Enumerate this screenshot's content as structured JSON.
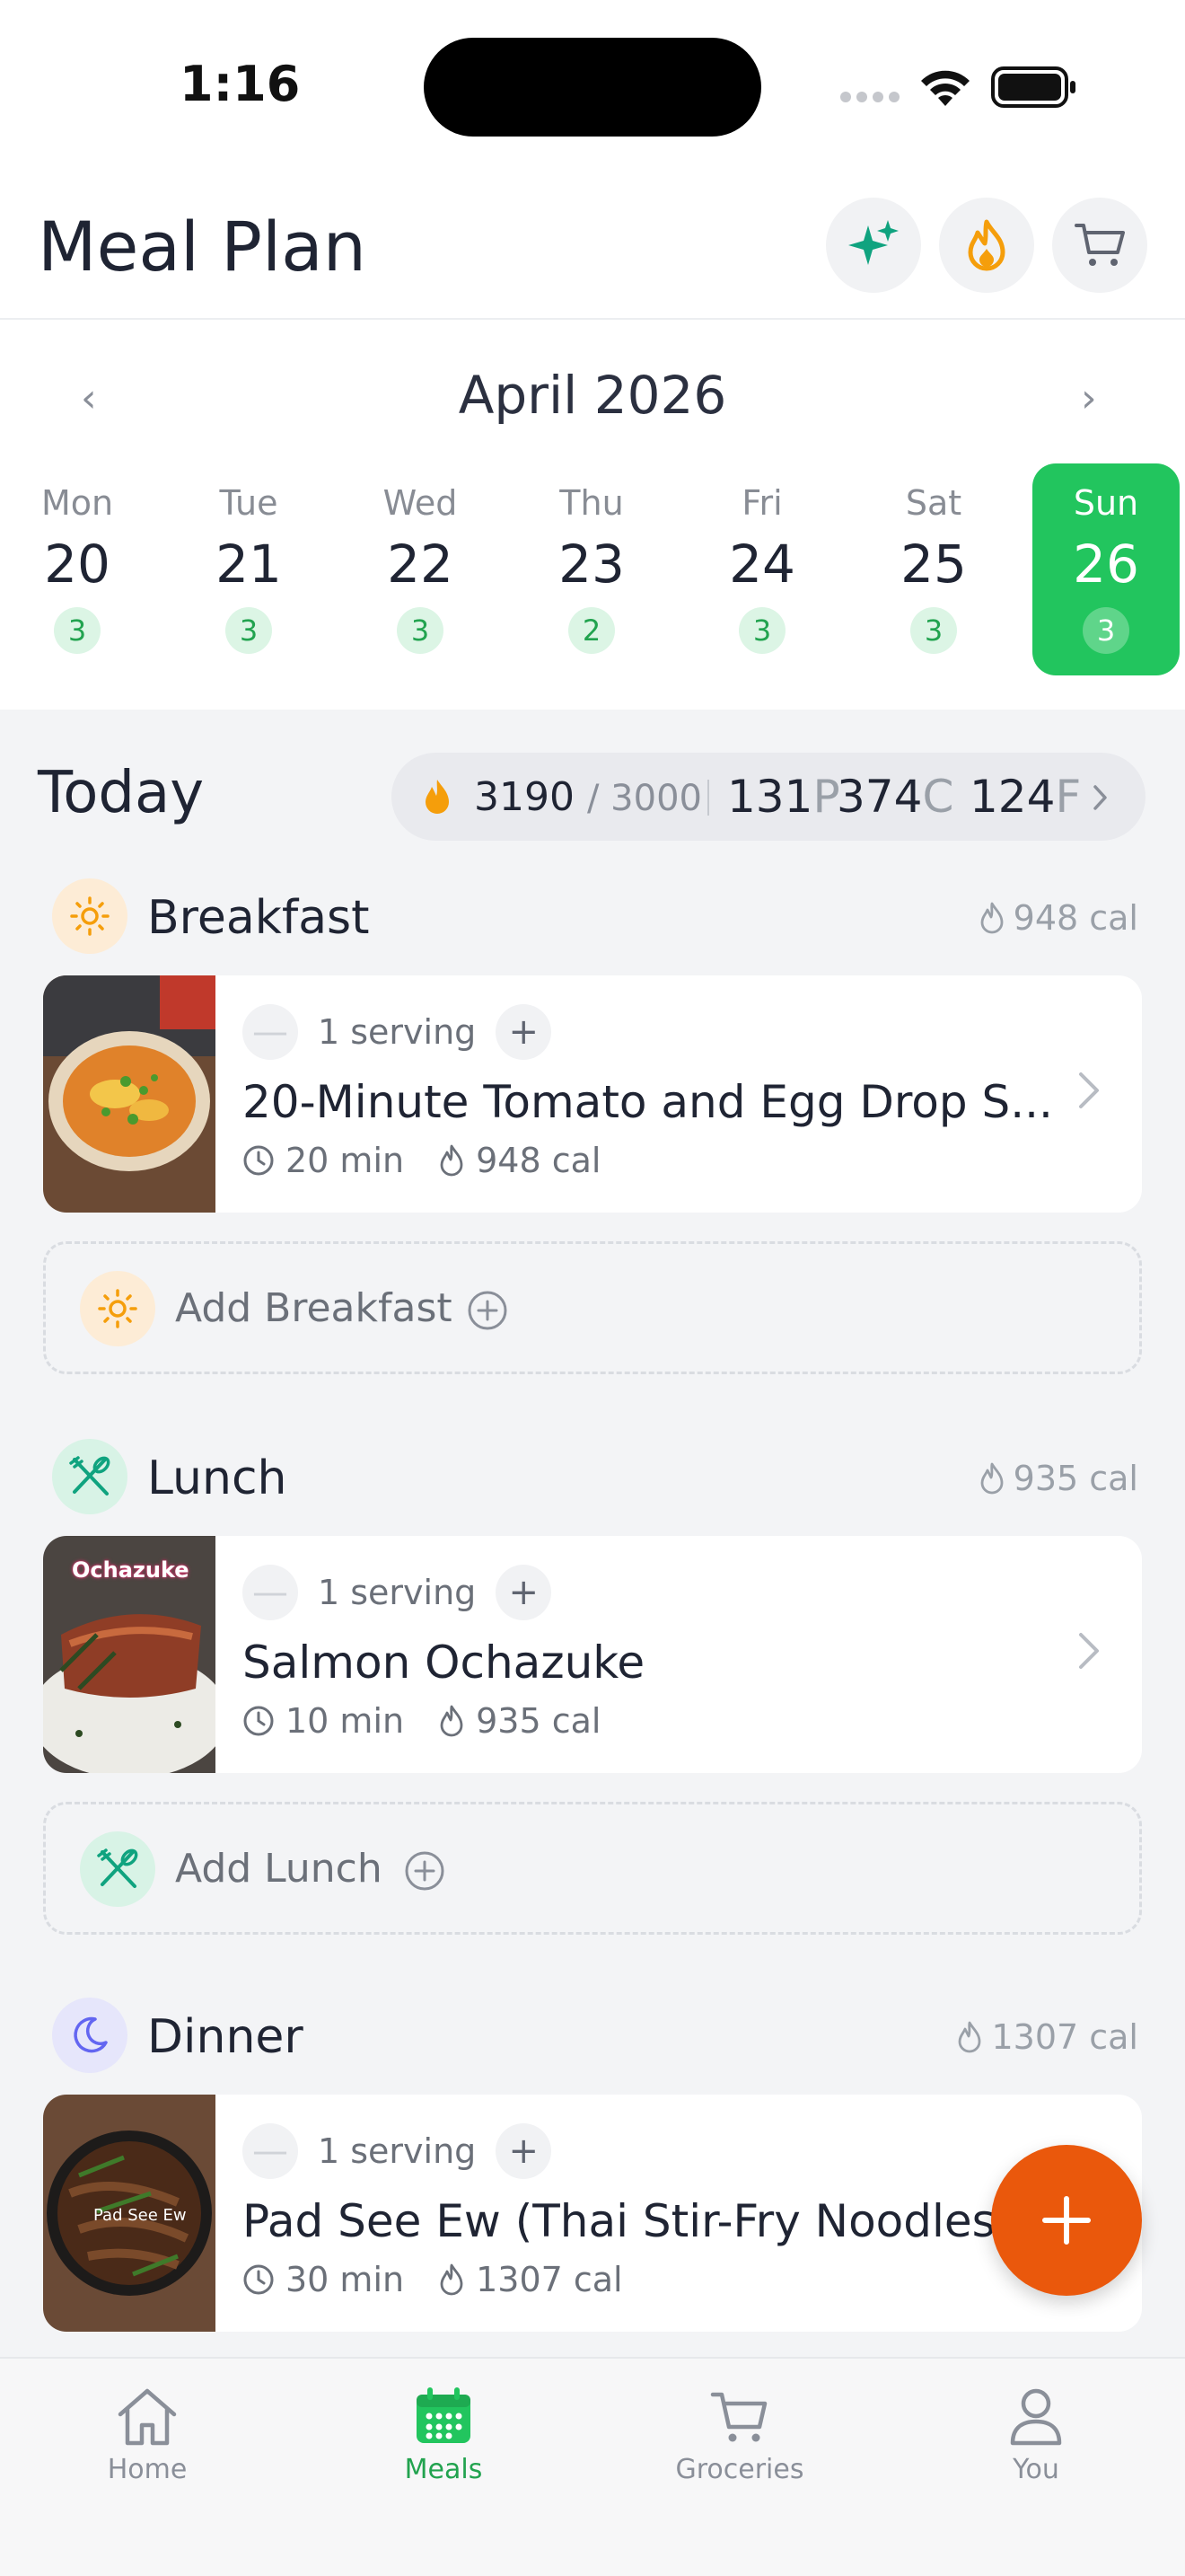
{
  "status_bar": {
    "time": "1:16"
  },
  "header": {
    "title": "Meal Plan",
    "buttons": [
      "sparkles-icon",
      "flame-icon",
      "cart-icon"
    ]
  },
  "calendar": {
    "month": "April 2026",
    "prev": "‹",
    "next": "›",
    "days": [
      {
        "name": "Mon",
        "num": "20",
        "count": "3"
      },
      {
        "name": "Tue",
        "num": "21",
        "count": "3"
      },
      {
        "name": "Wed",
        "num": "22",
        "count": "3"
      },
      {
        "name": "Thu",
        "num": "23",
        "count": "2"
      },
      {
        "name": "Fri",
        "num": "24",
        "count": "3"
      },
      {
        "name": "Sat",
        "num": "25",
        "count": "3"
      },
      {
        "name": "Sun",
        "num": "26",
        "count": "3"
      }
    ],
    "selected": "Sun"
  },
  "today": {
    "title": "Today",
    "kcal": "3190",
    "kcal_goal": "/ 3000",
    "protein": "131",
    "protein_unit": "P",
    "carbs": "374",
    "carbs_unit": "C",
    "fat": "124",
    "fat_unit": "F"
  },
  "meals": {
    "breakfast": {
      "title": "Breakfast",
      "total": "948 cal",
      "serving": "1 serving",
      "name": "20-Minute Tomato and Egg Drop S...",
      "time": "20 min",
      "cal": "948 cal",
      "add_label": "Add Breakfast"
    },
    "lunch": {
      "title": "Lunch",
      "total": "935 cal",
      "serving": "1 serving",
      "name": "Salmon Ochazuke",
      "time": "10 min",
      "cal": "935 cal",
      "add_label": "Add Lunch",
      "thumb_text": "Ochazuke"
    },
    "dinner": {
      "title": "Dinner",
      "total": "1307 cal",
      "serving": "1 serving",
      "name": "Pad See Ew (Thai Stir-Fry Noodles)",
      "time": "30 min",
      "cal": "1307 cal",
      "thumb_text": "Pad See Ew"
    }
  },
  "tabbar": {
    "tabs": [
      {
        "label": "Home",
        "icon": "home-icon"
      },
      {
        "label": "Meals",
        "icon": "calendar-icon"
      },
      {
        "label": "Groceries",
        "icon": "cart-icon"
      },
      {
        "label": "You",
        "icon": "person-icon"
      }
    ],
    "active": "Meals"
  },
  "colors": {
    "accent_green": "#22c55e",
    "fab_orange": "#ea580c",
    "flame_orange": "#f59e0b"
  }
}
